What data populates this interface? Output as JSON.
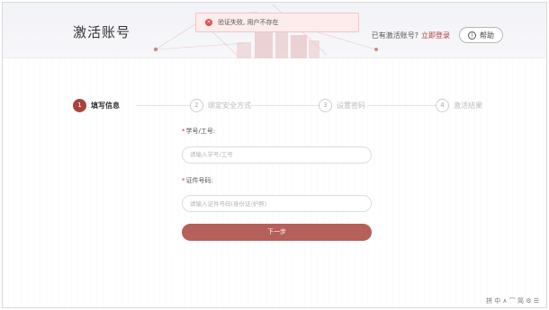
{
  "header": {
    "title": "激活账号",
    "have_account_text": "已有激活账号?",
    "login_link": "立即登录",
    "help_label": "帮助",
    "help_icon": "i"
  },
  "toast": {
    "icon": "×",
    "message": "验证失败, 用户不存在"
  },
  "steps": [
    {
      "num": "1",
      "label": "填写信息",
      "active": true
    },
    {
      "num": "2",
      "label": "绑定安全方式",
      "active": false
    },
    {
      "num": "3",
      "label": "设置密码",
      "active": false
    },
    {
      "num": "4",
      "label": "激活结果",
      "active": false
    }
  ],
  "form": {
    "student_id": {
      "required": "*",
      "label": "学号/工号:",
      "placeholder": "请输入学号/工号"
    },
    "id_number": {
      "required": "*",
      "label": "证件号码:",
      "placeholder": "请输入证件号码(身份证/护照)"
    },
    "next_label": "下一步"
  },
  "tray": {
    "text": "拼 中 ∧ ⌒ 简 ⚙ ☰"
  },
  "colors": {
    "accent": "#a8433e",
    "button": "#b5605a",
    "error": "#e05050"
  }
}
